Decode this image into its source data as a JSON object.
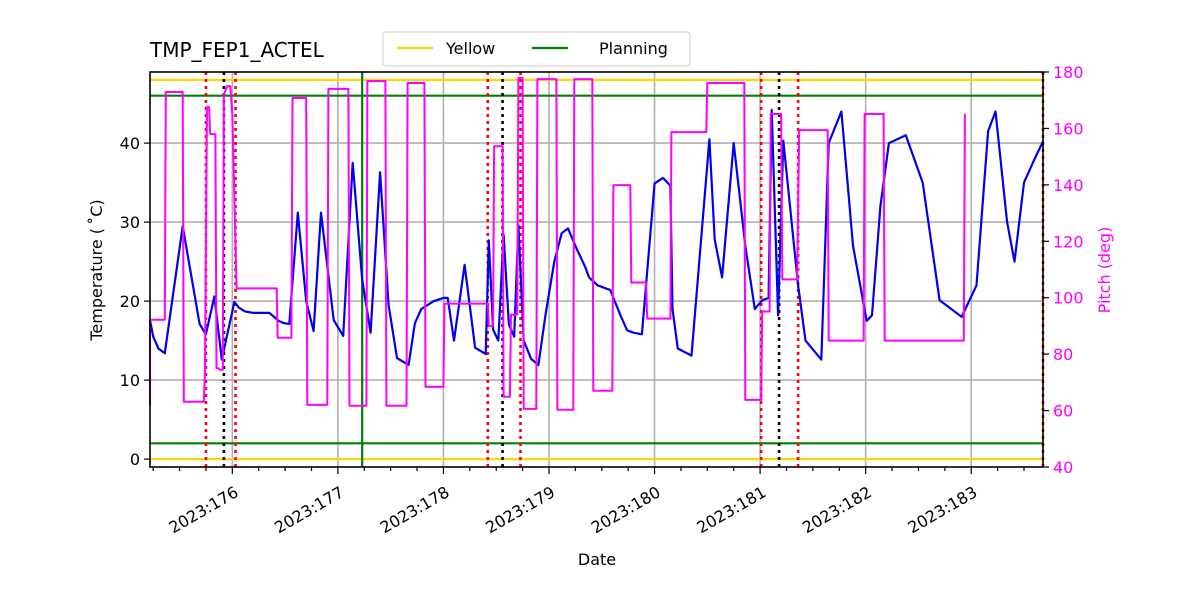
{
  "chart_data": {
    "type": "line",
    "title": "TMP_FEP1_ACTEL",
    "xlabel": "Date",
    "ylabel": "Temperature ($^\\circ$C)",
    "ylabel_display": "Temperature ( ˚C)",
    "y2label": "Pitch (deg)",
    "xlim": [
      175.22,
      183.68
    ],
    "ylim": [
      -1.0,
      49.0
    ],
    "y2lim": [
      40,
      180
    ],
    "grid": true,
    "legend_placement": "top-center-outside",
    "x_ticks": [
      176,
      177,
      178,
      179,
      180,
      181,
      182,
      183
    ],
    "x_tick_labels": [
      "2023:176",
      "2023:177",
      "2023:178",
      "2023:179",
      "2023:180",
      "2023:181",
      "2023:182",
      "2023:183"
    ],
    "y_ticks": [
      0,
      10,
      20,
      30,
      40
    ],
    "y_tick_labels": [
      "0",
      "10",
      "20",
      "30",
      "40"
    ],
    "y2_ticks": [
      40,
      60,
      80,
      100,
      120,
      140,
      160,
      180
    ],
    "y2_tick_labels": [
      "40",
      "60",
      "80",
      "100",
      "120",
      "140",
      "160",
      "180"
    ],
    "colors": {
      "temperature": "#0000ee",
      "pitch": "#ff00ff",
      "yellow": "#ffd700",
      "planning": "#008000",
      "grid": "#b0b0b0",
      "red_marker": "#ff0000",
      "black_marker": "#000000",
      "right_axis": "#ff00ff"
    },
    "legend": [
      {
        "label": "Yellow",
        "color": "#ffd700"
      },
      {
        "label": "Planning",
        "color": "#008000"
      }
    ],
    "limits": [
      {
        "name": "yellow-high",
        "kind": "Yellow",
        "value": 48.0
      },
      {
        "name": "planning-high",
        "kind": "Planning",
        "value": 46.0
      },
      {
        "name": "planning-low",
        "kind": "Planning",
        "value": 2.0
      },
      {
        "name": "yellow-low",
        "kind": "Yellow",
        "value": 0.0
      }
    ],
    "vertical_markers": [
      {
        "day": 175.75,
        "color": "red",
        "style": "dotted"
      },
      {
        "day": 175.92,
        "color": "black",
        "style": "dotted"
      },
      {
        "day": 176.03,
        "color": "red",
        "style": "dotted"
      },
      {
        "day": 177.23,
        "color": "green",
        "style": "solid"
      },
      {
        "day": 178.42,
        "color": "red",
        "style": "dotted"
      },
      {
        "day": 178.56,
        "color": "black",
        "style": "dotted"
      },
      {
        "day": 178.73,
        "color": "red",
        "style": "dotted"
      },
      {
        "day": 181.01,
        "color": "red",
        "style": "dotted"
      },
      {
        "day": 181.18,
        "color": "black",
        "style": "dotted"
      },
      {
        "day": 181.36,
        "color": "red",
        "style": "dotted"
      },
      {
        "day": 183.68,
        "color": "red",
        "style": "dotted"
      }
    ],
    "series": [
      {
        "name": "Temperature",
        "axis": "left",
        "x": [
          175.22,
          175.25,
          175.3,
          175.36,
          175.53,
          175.69,
          175.75,
          175.83,
          175.9,
          175.93,
          176.02,
          176.06,
          176.12,
          176.2,
          176.29,
          176.35,
          176.44,
          176.49,
          176.54,
          176.62,
          176.7,
          176.77,
          176.84,
          176.96,
          177.05,
          177.14,
          177.23,
          177.31,
          177.4,
          177.48,
          177.56,
          177.67,
          177.73,
          177.79,
          177.91,
          178.0,
          178.04,
          178.1,
          178.2,
          178.3,
          178.4,
          178.43,
          178.47,
          178.52,
          178.57,
          178.62,
          178.67,
          178.71,
          178.76,
          178.83,
          178.9,
          178.97,
          179.05,
          179.12,
          179.18,
          179.26,
          179.34,
          179.38,
          179.46,
          179.58,
          179.68,
          179.74,
          179.8,
          179.88,
          180.0,
          180.08,
          180.15,
          180.17,
          180.22,
          180.35,
          180.52,
          180.57,
          180.64,
          180.75,
          180.86,
          180.95,
          181.02,
          181.08,
          181.11,
          181.17,
          181.22,
          181.36,
          181.43,
          181.58,
          181.65,
          181.77,
          181.88,
          182.01,
          182.06,
          182.14,
          182.22,
          182.38,
          182.54,
          182.7,
          182.91,
          183.05,
          183.16,
          183.23,
          183.34,
          183.41,
          183.5,
          183.6,
          183.68
        ],
        "y": [
          17.6,
          15.5,
          14.0,
          13.4,
          29.5,
          17.1,
          15.8,
          20.6,
          12.6,
          14.4,
          19.9,
          19.2,
          18.7,
          18.5,
          18.5,
          18.5,
          17.5,
          17.2,
          17.1,
          31.2,
          20.0,
          16.2,
          31.2,
          17.6,
          15.6,
          37.5,
          22.7,
          16.0,
          36.3,
          19.5,
          12.8,
          11.9,
          17.2,
          19.0,
          20.0,
          20.4,
          20.4,
          15.0,
          24.6,
          14.1,
          13.3,
          27.7,
          16.4,
          15.0,
          28.4,
          17.0,
          15.5,
          29.6,
          15.0,
          12.7,
          11.9,
          18.5,
          25.0,
          28.6,
          29.2,
          26.7,
          24.4,
          23.0,
          22.0,
          21.4,
          18.1,
          16.3,
          16.0,
          15.8,
          34.9,
          35.6,
          34.6,
          19.0,
          14.0,
          13.1,
          40.5,
          27.8,
          23.0,
          40.0,
          27.0,
          19.0,
          20.1,
          20.4,
          44.2,
          18.2,
          40.3,
          22.0,
          15.0,
          12.6,
          40.0,
          44.0,
          27.0,
          17.5,
          18.2,
          32.0,
          40.0,
          41.0,
          35.0,
          20.1,
          18.0,
          22.0,
          41.5,
          44.0,
          30.0,
          25.0,
          35.0,
          38.0,
          40.2
        ]
      },
      {
        "name": "Pitch",
        "axis": "right",
        "x": [
          175.22,
          175.22,
          175.23,
          175.36,
          175.37,
          175.53,
          175.54,
          175.73,
          175.74,
          175.76,
          175.78,
          175.79,
          175.84,
          175.85,
          175.87,
          175.88,
          175.91,
          175.92,
          175.95,
          175.98,
          176.0,
          176.04,
          176.05,
          176.42,
          176.43,
          176.56,
          176.57,
          176.7,
          176.71,
          176.9,
          176.91,
          177.1,
          177.11,
          177.27,
          177.28,
          177.45,
          177.46,
          177.65,
          177.66,
          177.82,
          177.83,
          178.0,
          178.01,
          178.42,
          178.43,
          178.47,
          178.48,
          178.56,
          178.57,
          178.63,
          178.64,
          178.7,
          178.71,
          178.75,
          178.76,
          178.88,
          178.89,
          179.07,
          179.08,
          179.23,
          179.24,
          179.41,
          179.42,
          179.6,
          179.61,
          179.77,
          179.78,
          179.92,
          179.93,
          180.15,
          180.16,
          180.49,
          180.5,
          180.85,
          180.86,
          181.01,
          181.02,
          181.09,
          181.1,
          181.2,
          181.21,
          181.35,
          181.37,
          181.64,
          181.65,
          181.98,
          181.99,
          182.17,
          182.18,
          182.93,
          182.94,
          183.18,
          183.19,
          183.43,
          183.44,
          183.68
        ],
        "y": [
          62.0,
          92.2,
          92.2,
          92.2,
          172.9,
          172.9,
          63.1,
          63.1,
          73.0,
          167.6,
          167.6,
          158.0,
          158.0,
          75.0,
          75.0,
          74.5,
          74.5,
          172.0,
          175.0,
          175.0,
          165.0,
          103.3,
          103.3,
          103.3,
          85.8,
          85.8,
          170.8,
          170.8,
          62.0,
          62.0,
          174.0,
          174.0,
          61.7,
          61.7,
          176.8,
          176.8,
          61.7,
          61.7,
          176.1,
          176.1,
          68.4,
          68.4,
          97.9,
          97.9,
          90.0,
          90.0,
          153.7,
          153.7,
          64.9,
          64.9,
          94.0,
          94.0,
          177.9,
          177.9,
          60.6,
          60.6,
          177.5,
          177.5,
          60.3,
          60.3,
          177.5,
          177.5,
          67.0,
          67.0,
          139.9,
          139.9,
          105.4,
          105.4,
          92.6,
          92.6,
          158.7,
          158.7,
          176.1,
          176.1,
          63.8,
          63.8,
          95.1,
          95.1,
          165.1,
          165.1,
          106.5,
          106.5,
          159.4,
          159.4,
          84.8,
          84.8,
          165.1,
          165.1,
          84.8,
          84.8,
          165.1
        ]
      }
    ]
  }
}
